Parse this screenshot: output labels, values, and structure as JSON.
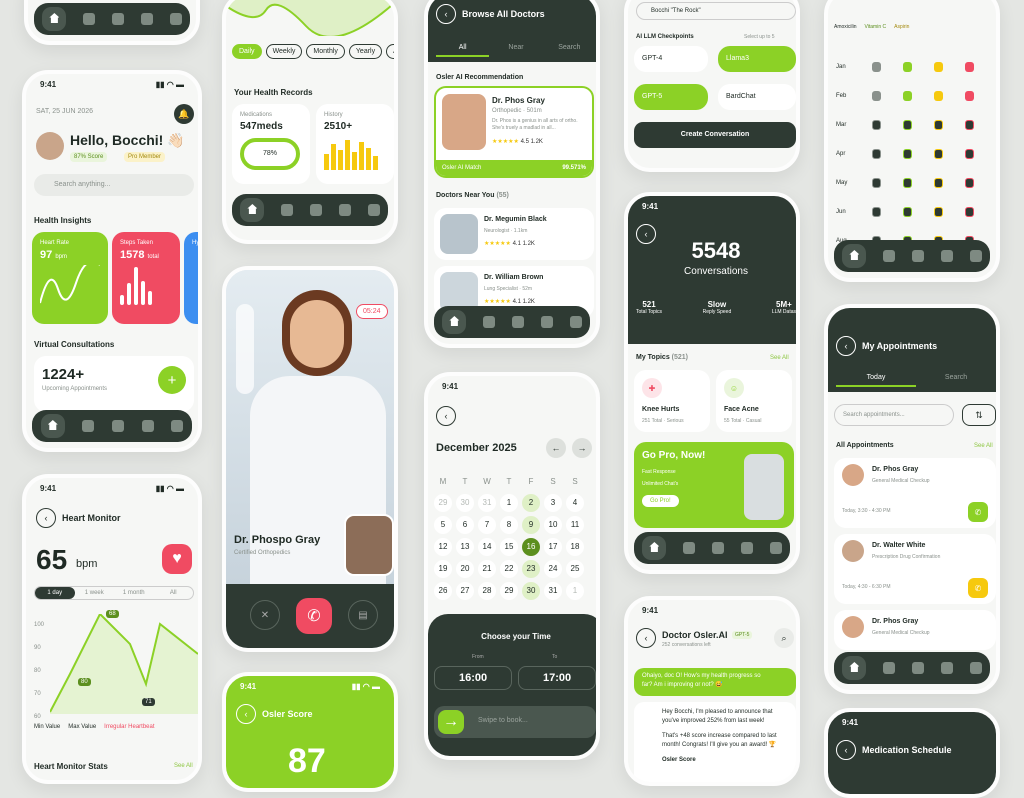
{
  "time": "9:41",
  "home": {
    "date": "SAT, 25 JUN 2026",
    "greeting": "Hello, Bocchi! 👋🏻",
    "score": "87% Score",
    "member": "Pro Member",
    "search": "Search anything...",
    "insights": "Health Insights",
    "hr_label": "Heart Rate",
    "hr_val": "97",
    "hr_unit": "bpm",
    "steps_label": "Steps Taken",
    "steps_val": "1578",
    "steps_unit": "total",
    "hy": "Hy",
    "virtual": "Virtual Consultations",
    "appts": "1224+",
    "appts_label": "Upcoming Appointments"
  },
  "heart": {
    "title": "Heart Monitor",
    "bpm": "65",
    "unit": "bpm",
    "tabs": [
      "1 day",
      "1 week",
      "1 month",
      "All"
    ],
    "y": [
      "100",
      "90",
      "80",
      "70",
      "60"
    ],
    "pts": [
      "68",
      "80",
      "71"
    ],
    "legend": [
      "Min Value",
      "Max Value",
      "Irregular Heartbeat"
    ],
    "stats": "Heart Monitor Stats",
    "see": "See All"
  },
  "records": {
    "filters": [
      "Daily",
      "Weekly",
      "Monthly",
      "Yearly",
      "All"
    ],
    "title": "Your Health Records",
    "med_label": "Medications",
    "med_val": "547meds",
    "med_pct": "78%",
    "hist_label": "History",
    "hist_val": "2510+"
  },
  "video": {
    "time": "05:24",
    "name": "Dr. Phospo Gray",
    "role": "Certified Orthopedics"
  },
  "osler_score": {
    "title": "Osler Score",
    "val": "87"
  },
  "browse": {
    "title": "Browse All Doctors",
    "tabs": [
      "All",
      "Near",
      "Search"
    ],
    "rec": "Osler AI Recommendation",
    "doc": "Dr. Phos Gray",
    "spec": "Orthopedic",
    "dist": "501m",
    "desc": "Dr. Phos is a genius in all arts of ortho. She's truely a madlad in all...",
    "rating": "4.5",
    "reviews": "1.2K",
    "match": "Osler AI Match",
    "match_val": "99.571%",
    "near": "Doctors Near You",
    "near_n": "(55)",
    "d1": "Dr. Megumin Black",
    "d1s": "Neurologist",
    "d1d": "1.1km",
    "d1r": "4.1",
    "d1c": "1.2K",
    "d2": "Dr. William Brown",
    "d2s": "Lung Specialist",
    "d2d": "52m",
    "d2r": "4.1",
    "d2c": "1.2K"
  },
  "calendar": {
    "month": "December 2025",
    "days": [
      "M",
      "T",
      "W",
      "T",
      "F",
      "S",
      "S"
    ],
    "rows": [
      [
        "29",
        "30",
        "31",
        "1",
        "2",
        "3",
        "4"
      ],
      [
        "5",
        "6",
        "7",
        "8",
        "9",
        "10",
        "11"
      ],
      [
        "12",
        "13",
        "14",
        "15",
        "16",
        "17",
        "18"
      ],
      [
        "19",
        "20",
        "21",
        "22",
        "23",
        "24",
        "25"
      ],
      [
        "26",
        "27",
        "28",
        "29",
        "30",
        "31",
        "1"
      ]
    ],
    "choose": "Choose your Time",
    "from": "From",
    "to": "To",
    "t1": "16:00",
    "t2": "17:00",
    "swipe": "Swipe to book..."
  },
  "llm": {
    "user": "Bocchi \"The Rock\"",
    "title": "AI LLM Checkpoints",
    "sel": "Select up to 5",
    "opts": [
      "GPT-4",
      "Llama3",
      "GPT-5",
      "BardChat"
    ],
    "create": "Create Conversation"
  },
  "convo": {
    "num": "5548",
    "label": "Conversations",
    "s1": "521",
    "s1l": "Total Topics",
    "s2": "Slow",
    "s2l": "Reply Speed",
    "s3": "5M+",
    "s3l": "LLM Datas",
    "topics": "My Topics",
    "topics_n": "(521)",
    "see": "See All",
    "tp1": "Knee Hurts",
    "tp1s": "251 Total · Serious",
    "tp2": "Face Acne",
    "tp2s": "55 Total · Casual",
    "pro": "Go Pro, Now!",
    "f1": "Fast Response",
    "f2": "Unlimited Chat's",
    "gopro": "Go Pro!"
  },
  "chat": {
    "title": "Doctor Osler.AI",
    "badge": "GPT-5",
    "left": "252 conversations left",
    "m1": "Ohaiyo, doc O! How's my health progress so far? Am i improving or not? 😅",
    "m2": "Hey Bocchi, I'm pleased to announce that you've improved 252% from last week!",
    "m3": "That's +48 score increase compared to last month! Congrats! I'll give you an award! 🏆",
    "score": "Osler Score"
  },
  "meds": {
    "legend": [
      "Amoxicilin",
      "Vitamin C",
      "Aspirin"
    ],
    "months": [
      "Jan",
      "Feb",
      "Mar",
      "Apr",
      "May",
      "Jun",
      "Aug"
    ]
  },
  "appts": {
    "title": "My Appointments",
    "tabs": [
      "Today",
      "Search"
    ],
    "search": "Search appointments...",
    "all": "All Appointments",
    "see": "See All",
    "a1": "Dr. Phos Gray",
    "a1s": "General Medical Checkup",
    "a1t": "Today, 3:30 - 4:30 PM",
    "a2": "Dr. Walter White",
    "a2s": "Prescription Drug Confirmation",
    "a2t": "Today, 4:30 - 6:30 PM",
    "a3": "Dr. Phos Gray",
    "a3s": "General Medical Checkup"
  },
  "medsched": {
    "title": "Medication Schedule"
  }
}
